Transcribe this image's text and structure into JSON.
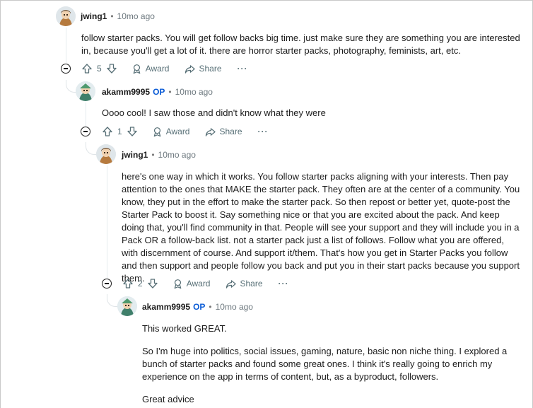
{
  "comments": [
    {
      "username": "jwing1",
      "op_badge": "",
      "time": "10mo ago",
      "paragraphs": [
        "follow starter packs. You will get follow backs big time. just make sure they are something you are interested in, because you'll get a lot of it. there are horror starter packs, photography, feminists, art, etc."
      ],
      "votes": "5",
      "award_label": "Award",
      "share_label": "Share",
      "more_label": "···"
    },
    {
      "username": "akamm9995",
      "op_badge": "OP",
      "time": "10mo ago",
      "paragraphs": [
        "Oooo cool! I saw those and didn't know what they were"
      ],
      "votes": "1",
      "award_label": "Award",
      "share_label": "Share",
      "more_label": "···"
    },
    {
      "username": "jwing1",
      "op_badge": "",
      "time": "10mo ago",
      "paragraphs": [
        "here's one way in which it works. You follow starter packs aligning with your interests. Then pay attention to the ones that MAKE the starter pack. They often are at the center of a community. You know, they put in the effort to make the starter pack. So then repost or better yet, quote-post the Starter Pack to boost it. Say something nice or that you are excited about the pack. And keep doing that, you'll find community in that. People will see your support and they will include you in a Pack OR a follow-back list. not a starter pack just a list of follows. Follow what you are offered, with discernment of course. And support it/them. That's how you get in Starter Packs you follow and then support and people follow you back and put you in their start packs because you support them."
      ],
      "votes": "2",
      "award_label": "Award",
      "share_label": "Share",
      "more_label": "···"
    },
    {
      "username": "akamm9995",
      "op_badge": "OP",
      "time": "10mo ago",
      "paragraphs": [
        "This worked GREAT.",
        "So I'm huge into politics, social issues, gaming, nature, basic non niche thing. I explored a bunch of starter packs and found some great ones. I think it's really going to enrich my experience on the app in terms of content, but, as a byproduct, followers.",
        "Great advice"
      ]
    }
  ],
  "separator": "•"
}
